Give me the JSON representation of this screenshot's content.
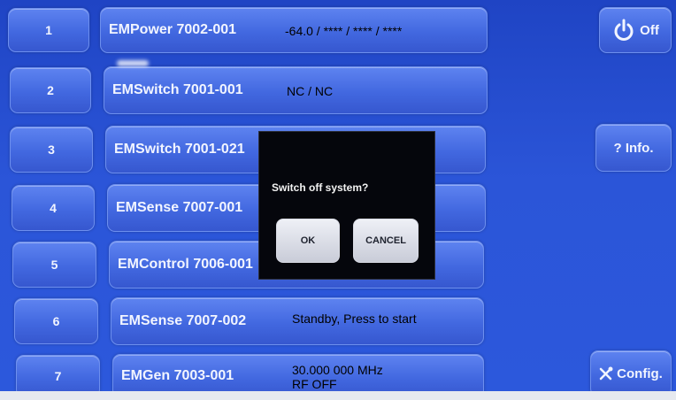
{
  "rows": [
    {
      "number": "1",
      "device": "EMPower 7002-001",
      "status": "-64.0 / ****  / ****  / ****"
    },
    {
      "number": "2",
      "device": "EMSwitch 7001-001",
      "status": "NC / NC"
    },
    {
      "number": "3",
      "device": "EMSwitch 7001-021",
      "status": ""
    },
    {
      "number": "4",
      "device": "EMSense 7007-001",
      "status": ""
    },
    {
      "number": "5",
      "device": "EMControl 7006-001",
      "status": ""
    },
    {
      "number": "6",
      "device": "EMSense 7007-002",
      "status": "Standby, Press to start"
    },
    {
      "number": "7",
      "device": "EMGen 7003-001",
      "status": "30.000 000 MHz",
      "status_line2": "RF OFF"
    }
  ],
  "side": {
    "off_label": "Off",
    "off_icon": "power-icon",
    "info_label": "? Info.",
    "config_label": "Config.",
    "config_icon": "tools-icon"
  },
  "dialog": {
    "message": "Switch off system?",
    "ok_label": "OK",
    "cancel_label": "CANCEL"
  },
  "colors": {
    "screen_blue": "#2b55d8",
    "button_blue": "#4268e0",
    "dialog_bg": "#05060c",
    "dialog_button": "#d9dbe4"
  }
}
